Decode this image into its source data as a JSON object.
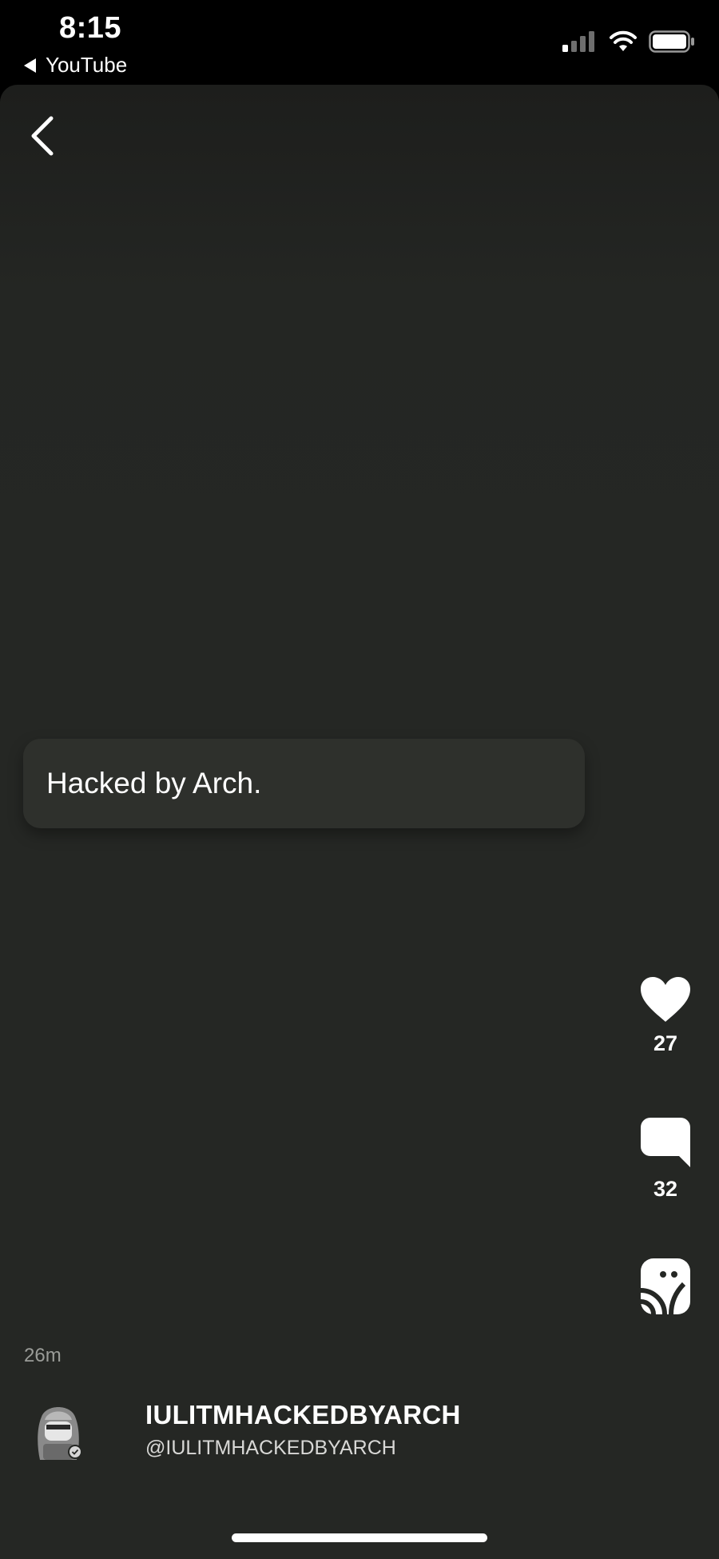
{
  "status_bar": {
    "time": "8:15",
    "back_app_label": "YouTube",
    "icons": [
      "signal-icon",
      "wifi-icon",
      "battery-icon"
    ]
  },
  "post": {
    "text": "Hacked by Arch.",
    "timestamp": "26m"
  },
  "actions": {
    "like": {
      "icon": "heart-icon",
      "count": "27"
    },
    "comment": {
      "icon": "comment-icon",
      "count": "32"
    },
    "share": {
      "icon": "share-icon"
    }
  },
  "author": {
    "name": "IULITMHACKEDBYARCH",
    "handle": "@IULITMHACKEDBYARCH",
    "verified": true
  },
  "colors": {
    "background": "#252724",
    "bubble": "#2e302c",
    "text": "#ffffff",
    "muted": "#9a9c98"
  }
}
